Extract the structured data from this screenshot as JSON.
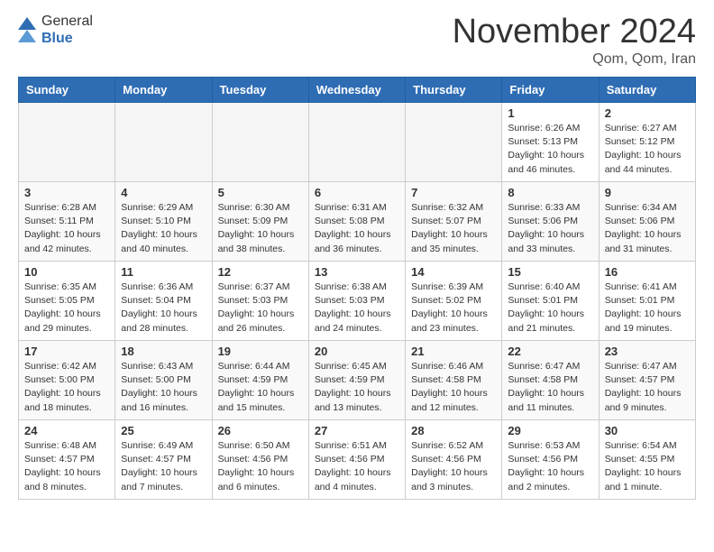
{
  "header": {
    "logo_general": "General",
    "logo_blue": "Blue",
    "title": "November 2024",
    "location": "Qom, Qom, Iran"
  },
  "weekdays": [
    "Sunday",
    "Monday",
    "Tuesday",
    "Wednesday",
    "Thursday",
    "Friday",
    "Saturday"
  ],
  "weeks": [
    [
      {
        "day": "",
        "info": "",
        "empty": true
      },
      {
        "day": "",
        "info": "",
        "empty": true
      },
      {
        "day": "",
        "info": "",
        "empty": true
      },
      {
        "day": "",
        "info": "",
        "empty": true
      },
      {
        "day": "",
        "info": "",
        "empty": true
      },
      {
        "day": "1",
        "info": "Sunrise: 6:26 AM\nSunset: 5:13 PM\nDaylight: 10 hours\nand 46 minutes.",
        "empty": false
      },
      {
        "day": "2",
        "info": "Sunrise: 6:27 AM\nSunset: 5:12 PM\nDaylight: 10 hours\nand 44 minutes.",
        "empty": false
      }
    ],
    [
      {
        "day": "3",
        "info": "Sunrise: 6:28 AM\nSunset: 5:11 PM\nDaylight: 10 hours\nand 42 minutes.",
        "empty": false
      },
      {
        "day": "4",
        "info": "Sunrise: 6:29 AM\nSunset: 5:10 PM\nDaylight: 10 hours\nand 40 minutes.",
        "empty": false
      },
      {
        "day": "5",
        "info": "Sunrise: 6:30 AM\nSunset: 5:09 PM\nDaylight: 10 hours\nand 38 minutes.",
        "empty": false
      },
      {
        "day": "6",
        "info": "Sunrise: 6:31 AM\nSunset: 5:08 PM\nDaylight: 10 hours\nand 36 minutes.",
        "empty": false
      },
      {
        "day": "7",
        "info": "Sunrise: 6:32 AM\nSunset: 5:07 PM\nDaylight: 10 hours\nand 35 minutes.",
        "empty": false
      },
      {
        "day": "8",
        "info": "Sunrise: 6:33 AM\nSunset: 5:06 PM\nDaylight: 10 hours\nand 33 minutes.",
        "empty": false
      },
      {
        "day": "9",
        "info": "Sunrise: 6:34 AM\nSunset: 5:06 PM\nDaylight: 10 hours\nand 31 minutes.",
        "empty": false
      }
    ],
    [
      {
        "day": "10",
        "info": "Sunrise: 6:35 AM\nSunset: 5:05 PM\nDaylight: 10 hours\nand 29 minutes.",
        "empty": false
      },
      {
        "day": "11",
        "info": "Sunrise: 6:36 AM\nSunset: 5:04 PM\nDaylight: 10 hours\nand 28 minutes.",
        "empty": false
      },
      {
        "day": "12",
        "info": "Sunrise: 6:37 AM\nSunset: 5:03 PM\nDaylight: 10 hours\nand 26 minutes.",
        "empty": false
      },
      {
        "day": "13",
        "info": "Sunrise: 6:38 AM\nSunset: 5:03 PM\nDaylight: 10 hours\nand 24 minutes.",
        "empty": false
      },
      {
        "day": "14",
        "info": "Sunrise: 6:39 AM\nSunset: 5:02 PM\nDaylight: 10 hours\nand 23 minutes.",
        "empty": false
      },
      {
        "day": "15",
        "info": "Sunrise: 6:40 AM\nSunset: 5:01 PM\nDaylight: 10 hours\nand 21 minutes.",
        "empty": false
      },
      {
        "day": "16",
        "info": "Sunrise: 6:41 AM\nSunset: 5:01 PM\nDaylight: 10 hours\nand 19 minutes.",
        "empty": false
      }
    ],
    [
      {
        "day": "17",
        "info": "Sunrise: 6:42 AM\nSunset: 5:00 PM\nDaylight: 10 hours\nand 18 minutes.",
        "empty": false
      },
      {
        "day": "18",
        "info": "Sunrise: 6:43 AM\nSunset: 5:00 PM\nDaylight: 10 hours\nand 16 minutes.",
        "empty": false
      },
      {
        "day": "19",
        "info": "Sunrise: 6:44 AM\nSunset: 4:59 PM\nDaylight: 10 hours\nand 15 minutes.",
        "empty": false
      },
      {
        "day": "20",
        "info": "Sunrise: 6:45 AM\nSunset: 4:59 PM\nDaylight: 10 hours\nand 13 minutes.",
        "empty": false
      },
      {
        "day": "21",
        "info": "Sunrise: 6:46 AM\nSunset: 4:58 PM\nDaylight: 10 hours\nand 12 minutes.",
        "empty": false
      },
      {
        "day": "22",
        "info": "Sunrise: 6:47 AM\nSunset: 4:58 PM\nDaylight: 10 hours\nand 11 minutes.",
        "empty": false
      },
      {
        "day": "23",
        "info": "Sunrise: 6:47 AM\nSunset: 4:57 PM\nDaylight: 10 hours\nand 9 minutes.",
        "empty": false
      }
    ],
    [
      {
        "day": "24",
        "info": "Sunrise: 6:48 AM\nSunset: 4:57 PM\nDaylight: 10 hours\nand 8 minutes.",
        "empty": false
      },
      {
        "day": "25",
        "info": "Sunrise: 6:49 AM\nSunset: 4:57 PM\nDaylight: 10 hours\nand 7 minutes.",
        "empty": false
      },
      {
        "day": "26",
        "info": "Sunrise: 6:50 AM\nSunset: 4:56 PM\nDaylight: 10 hours\nand 6 minutes.",
        "empty": false
      },
      {
        "day": "27",
        "info": "Sunrise: 6:51 AM\nSunset: 4:56 PM\nDaylight: 10 hours\nand 4 minutes.",
        "empty": false
      },
      {
        "day": "28",
        "info": "Sunrise: 6:52 AM\nSunset: 4:56 PM\nDaylight: 10 hours\nand 3 minutes.",
        "empty": false
      },
      {
        "day": "29",
        "info": "Sunrise: 6:53 AM\nSunset: 4:56 PM\nDaylight: 10 hours\nand 2 minutes.",
        "empty": false
      },
      {
        "day": "30",
        "info": "Sunrise: 6:54 AM\nSunset: 4:55 PM\nDaylight: 10 hours\nand 1 minute.",
        "empty": false
      }
    ]
  ]
}
